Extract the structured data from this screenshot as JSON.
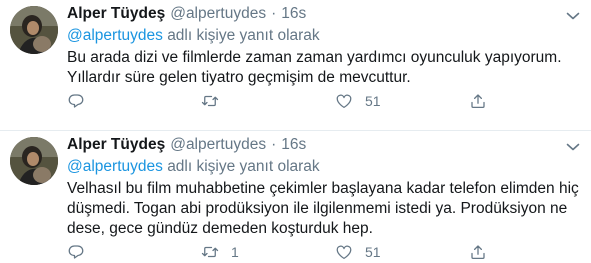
{
  "tweets": [
    {
      "name": "Alper Tüydeş",
      "handle": "@alpertuydes",
      "separator": "·",
      "time": "16s",
      "reply_mention": "@alpertuydes",
      "reply_suffix": "adlı kişiye yanıt olarak",
      "text_lines": [
        "Bu arada dizi ve filmlerde zaman zaman yardımcı oyunculuk yapıyorum.",
        "Yıllardır süre gelen tiyatro geçmişim de mevcuttur."
      ],
      "retweet_count": "",
      "like_count": "51"
    },
    {
      "name": "Alper Tüydeş",
      "handle": "@alpertuydes",
      "separator": "·",
      "time": "16s",
      "reply_mention": "@alpertuydes",
      "reply_suffix": "adlı kişiye yanıt olarak",
      "text_lines": [
        "Velhasıl bu film muhabbetine çekimler başlayana kadar telefon elimden hiç",
        "düşmedi. Togan abi prodüksiyon ile ilgilenmemi istedi ya. Prodüksiyon ne",
        "dese, gece gündüz demeden koşturduk hep."
      ],
      "retweet_count": "1",
      "like_count": "51"
    }
  ],
  "icons": {
    "reply": "reply-icon",
    "retweet": "retweet-icon",
    "like": "heart-icon",
    "share": "share-icon",
    "menu": "chevron-down-icon"
  },
  "colors": {
    "text": "#14171a",
    "secondary": "#657786",
    "link": "#1b95e0",
    "divider": "#e6ecf0"
  }
}
